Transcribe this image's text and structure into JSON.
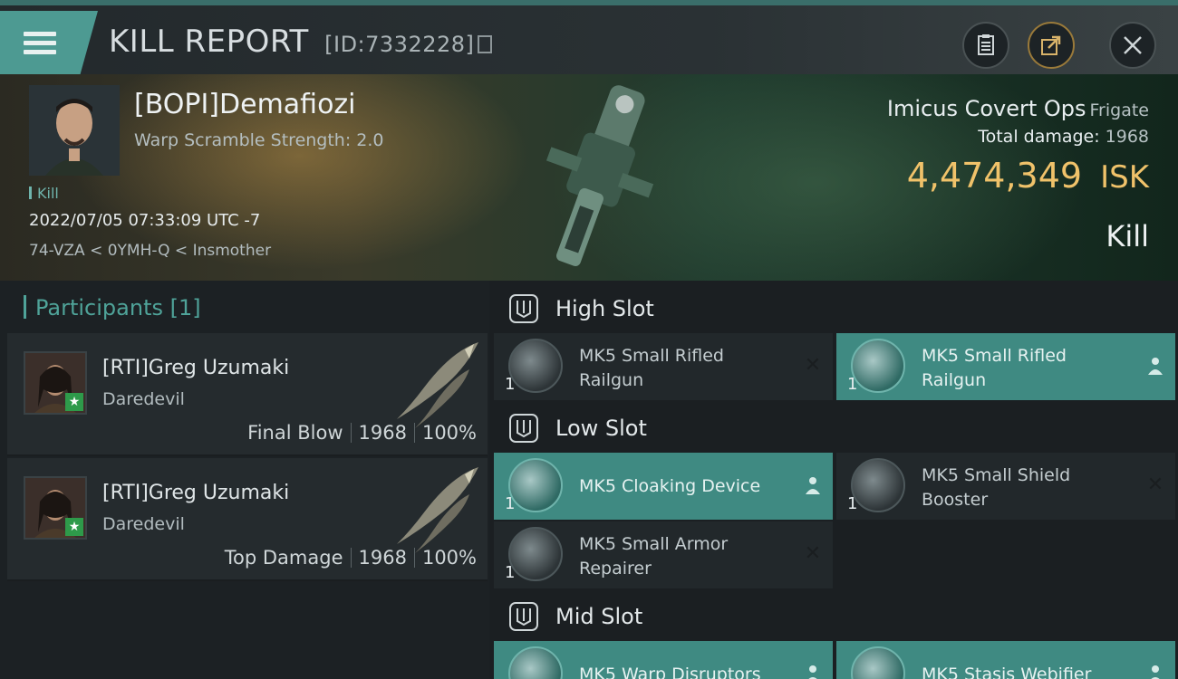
{
  "header": {
    "title": "KILL REPORT",
    "id_label": "[ID:7332228]",
    "icons": [
      "menu-icon",
      "copy-icon",
      "clipboard-icon",
      "share-icon",
      "close-icon"
    ]
  },
  "victim": {
    "name": "[BOPI]Demafiozi",
    "warp_scramble": "Warp Scramble Strength: 2.0",
    "tag": "Kill",
    "datetime": "2022/07/05 07:33:09 UTC -7",
    "location": "74-VZA < 0YMH-Q < Insmother"
  },
  "ship": {
    "name": "Imicus Covert Ops",
    "class": "Frigate",
    "damage_label": "Total damage:",
    "damage_value": "1968",
    "isk_value": "4,474,349",
    "isk_unit": "ISK",
    "result": "Kill"
  },
  "participants": {
    "title": "Participants [1]",
    "rows": [
      {
        "name": "[RTI]Greg Uzumaki",
        "ship": "Daredevil",
        "role": "Final Blow",
        "damage": "1968",
        "percent": "100%"
      },
      {
        "name": "[RTI]Greg Uzumaki",
        "ship": "Daredevil",
        "role": "Top Damage",
        "damage": "1968",
        "percent": "100%"
      }
    ]
  },
  "slots": {
    "high": {
      "label": "High Slot",
      "modules": [
        {
          "name": "MK5 Small Rifled Railgun",
          "qty": "1",
          "status": "destroyed"
        },
        {
          "name": "MK5 Small Rifled Railgun",
          "qty": "1",
          "status": "dropped"
        }
      ]
    },
    "low": {
      "label": "Low Slot",
      "modules": [
        {
          "name": "MK5 Cloaking Device",
          "qty": "1",
          "status": "dropped"
        },
        {
          "name": "MK5 Small Shield Booster",
          "qty": "1",
          "status": "destroyed"
        },
        {
          "name": "MK5 Small Armor Repairer",
          "qty": "1",
          "status": "destroyed"
        }
      ]
    },
    "mid": {
      "label": "Mid Slot",
      "modules": [
        {
          "name": "MK5 Warp Disruptors",
          "qty": "1",
          "status": "dropped"
        },
        {
          "name": "MK5 Stasis Webifier",
          "qty": "1",
          "status": "dropped"
        }
      ]
    }
  },
  "colors": {
    "accent": "#4d9a92",
    "isk": "#f0c26a",
    "teal_row": "#3f8a82"
  }
}
